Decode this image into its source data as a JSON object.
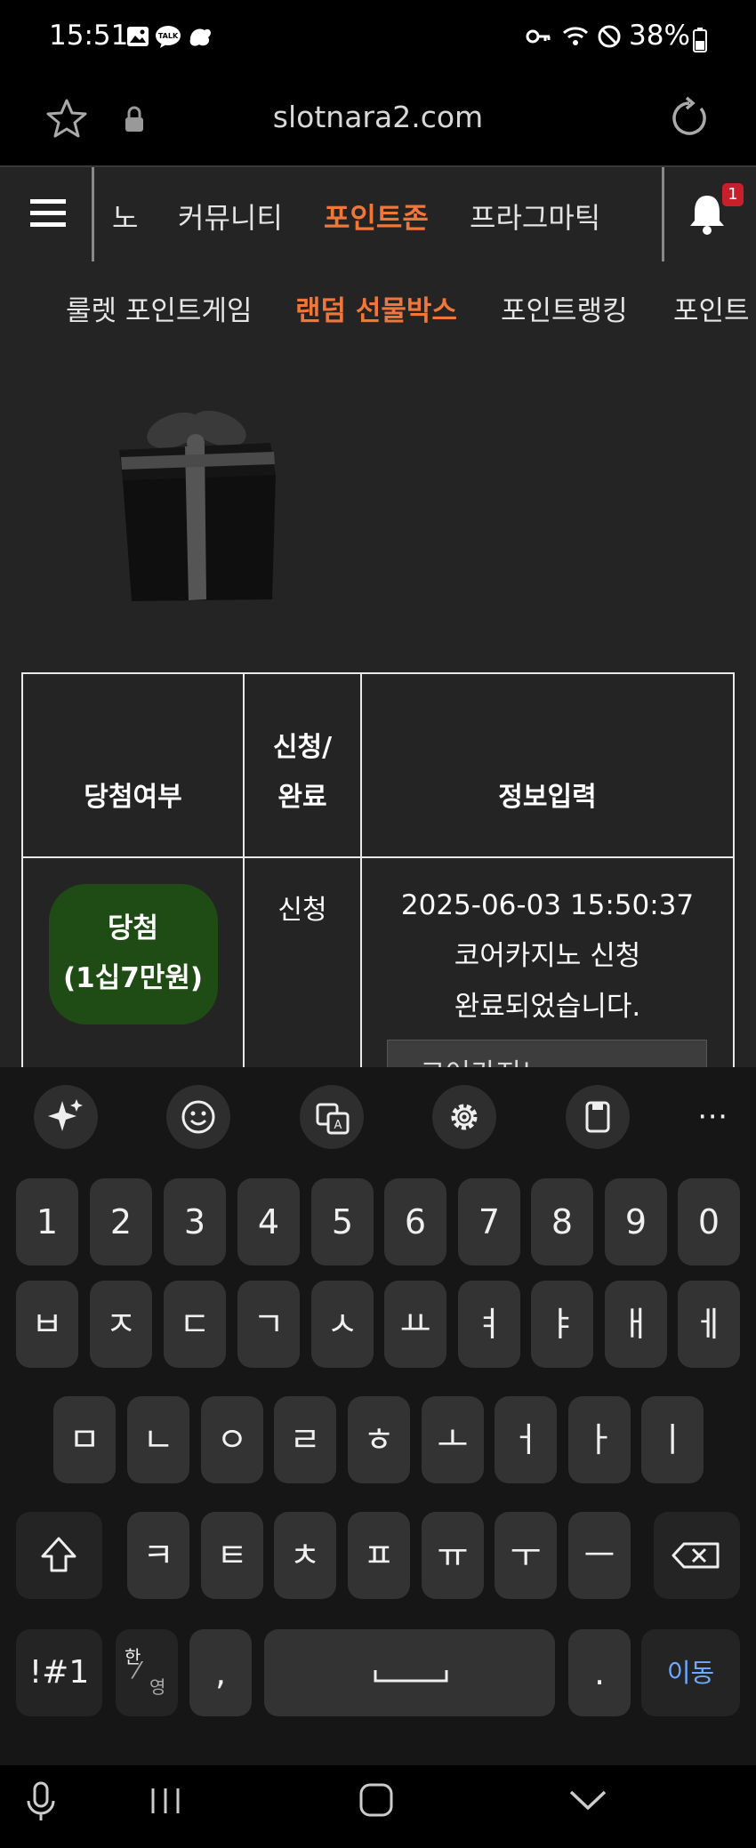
{
  "status_bar": {
    "time": "15:51",
    "battery": "38%"
  },
  "browser": {
    "url": "slotnara2.com"
  },
  "nav": {
    "items": [
      "노",
      "커뮤니티",
      "포인트존",
      "프라그마틱"
    ],
    "notification_count": "1"
  },
  "subnav": {
    "items": [
      "룰렛 포인트게임",
      "랜덤 선물박스",
      "포인트랭킹",
      "포인트"
    ]
  },
  "table": {
    "headers": [
      "당첨여부",
      "신청/\n완료",
      "정보입력"
    ],
    "row": {
      "result_line1": "당첨",
      "result_line2": "(1십7만원)",
      "status": "신청",
      "info_line1": "2025-06-03 15:50:37",
      "info_line2": "코어카지노 신청",
      "info_line3": "완료되었습니다.",
      "select_value": "코어카지노"
    }
  },
  "keyboard": {
    "numbers": [
      "1",
      "2",
      "3",
      "4",
      "5",
      "6",
      "7",
      "8",
      "9",
      "0"
    ],
    "row1": [
      "ㅂ",
      "ㅈ",
      "ㄷ",
      "ㄱ",
      "ㅅ",
      "ㅛ",
      "ㅕ",
      "ㅑ",
      "ㅐ",
      "ㅔ"
    ],
    "row2": [
      "ㅁ",
      "ㄴ",
      "ㅇ",
      "ㄹ",
      "ㅎ",
      "ㅗ",
      "ㅓ",
      "ㅏ",
      "ㅣ"
    ],
    "row3": [
      "ㅋ",
      "ㅌ",
      "ㅊ",
      "ㅍ",
      "ㅠ",
      "ㅜ",
      "ㅡ"
    ],
    "symbols_label": "!#1",
    "lang_top": "한",
    "lang_bottom": "영",
    "comma": ",",
    "period": ".",
    "enter_label": "이동"
  },
  "colors": {
    "accent": "#f0763a",
    "win_badge": "#1f4c14",
    "notification": "#c8202a",
    "enter_key_text": "#6fa8ff"
  }
}
